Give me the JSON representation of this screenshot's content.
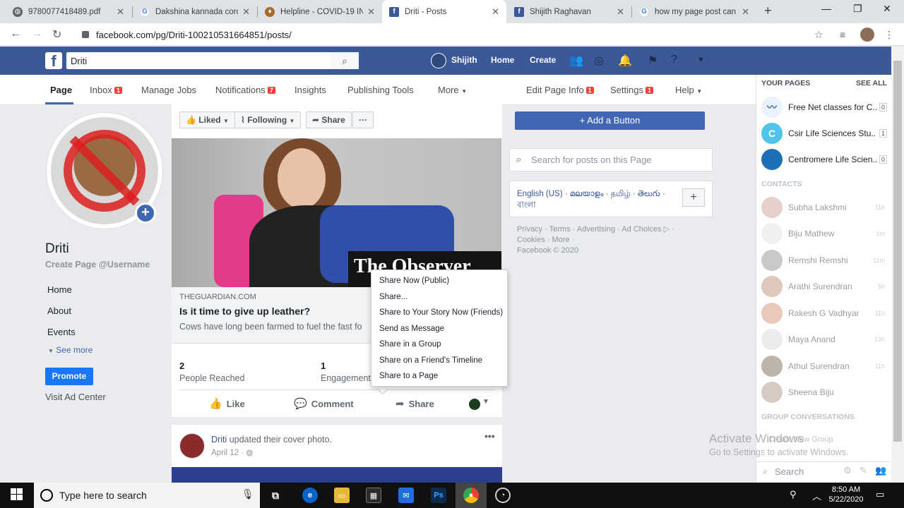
{
  "browser": {
    "tabs": [
      {
        "label": "9780077418489.pdf",
        "favicon": "globe-icon",
        "active": false
      },
      {
        "label": "Dakshina kannada coro",
        "favicon": "google-icon",
        "active": false
      },
      {
        "label": "Helpline - COVID-19 IN",
        "favicon": "emblem-icon",
        "active": false
      },
      {
        "label": "Driti - Posts",
        "favicon": "facebook-icon",
        "active": true
      },
      {
        "label": "Shijith Raghavan",
        "favicon": "facebook-icon",
        "active": false
      },
      {
        "label": "how my page post can",
        "favicon": "google-icon",
        "active": false
      }
    ],
    "url": "facebook.com/pg/Driti-100210531664851/posts/"
  },
  "fb": {
    "search_value": "Driti",
    "user_name": "Shijith",
    "nav_home": "Home",
    "nav_create": "Create"
  },
  "pagenav": {
    "page": "Page",
    "inbox": "Inbox",
    "inbox_badge": "1",
    "manage_jobs": "Manage Jobs",
    "notifications": "Notifications",
    "notifications_badge": "7",
    "insights": "Insights",
    "publishing_tools": "Publishing Tools",
    "more": "More",
    "edit_page_info": "Edit Page Info",
    "edit_badge": "1",
    "settings": "Settings",
    "settings_badge": "1",
    "help": "Help"
  },
  "left": {
    "page_name": "Driti",
    "username_link": "Create Page @Username",
    "links": [
      "Home",
      "About",
      "Events"
    ],
    "see_more": "See more",
    "promote": "Promote",
    "ad_center": "Visit Ad Center"
  },
  "post": {
    "liked": "Liked",
    "following": "Following",
    "share": "Share",
    "more_dots": "···",
    "image_caption": "The Observer",
    "link_domain": "THEGUARDIAN.COM",
    "link_title": "Is it time to give up leather?",
    "link_desc": "Cows have long been farmed to fuel the fast fo",
    "reached_count": "2",
    "reached_label": "People Reached",
    "engagement_count": "1",
    "engagement_label": "Engagement",
    "like": "Like",
    "comment": "Comment",
    "share_action": "Share"
  },
  "share_menu": [
    "Share Now (Public)",
    "Share...",
    "Share to Your Story Now (Friends)",
    "Send as Message",
    "Share in a Group",
    "Share on a Friend's Timeline",
    "Share to a Page"
  ],
  "post2": {
    "author": "Driti",
    "action": "updated their cover photo.",
    "date": "April 12 ·",
    "dots": "•••"
  },
  "right": {
    "add_button": "+ Add a Button",
    "search_placeholder": "Search for posts on this Page",
    "languages": "English (US) · മലയാളം · தமிழ் · తెలుగు · বাংলা",
    "lang_plus": "+",
    "footer_line1": "Privacy · Terms · Advertising · Ad Choices ▷ ·",
    "footer_line2": "Cookies · More ·",
    "footer_line3": "Facebook © 2020"
  },
  "chat": {
    "your_pages": "YOUR PAGES",
    "see_all": "SEE ALL",
    "pages": [
      {
        "name": "Free Net classes for C...",
        "count": "0",
        "color": "#eaf2fb",
        "letter": ""
      },
      {
        "name": "Csir Life Sciences Stu...",
        "count": "1",
        "color": "#4fc3e8",
        "letter": "C"
      },
      {
        "name": "Centromere Life Scien...",
        "count": "0",
        "color": "#1f6fb5",
        "letter": ""
      }
    ],
    "contacts_header": "CONTACTS",
    "contacts": [
      {
        "name": "Subha Lakshmi",
        "time": "11h"
      },
      {
        "name": "Biju Mathew",
        "time": "1m"
      },
      {
        "name": "Remshi Remshi",
        "time": "11m"
      },
      {
        "name": "Arathi Surendran",
        "time": "5h"
      },
      {
        "name": "Rakesh G Vadhyar",
        "time": "11h"
      },
      {
        "name": "Maya Anand",
        "time": "13h"
      },
      {
        "name": "Athul Surendran",
        "time": "11h"
      },
      {
        "name": "Sheena Biju",
        "time": ""
      }
    ],
    "group_header": "GROUP CONVERSATIONS",
    "new_group": "Create New Group",
    "search": "Search"
  },
  "watermark": {
    "line1": "Activate Windows",
    "line2": "Go to Settings to activate Windows."
  },
  "taskbar": {
    "search_text": "Type here to search",
    "time": "8:50 AM",
    "date": "5/22/2020"
  },
  "colors": {
    "fb_blue": "#3b5998",
    "fb_button": "#4267b2",
    "badge_red": "#fa3e3e",
    "promote_blue": "#1877f2"
  }
}
